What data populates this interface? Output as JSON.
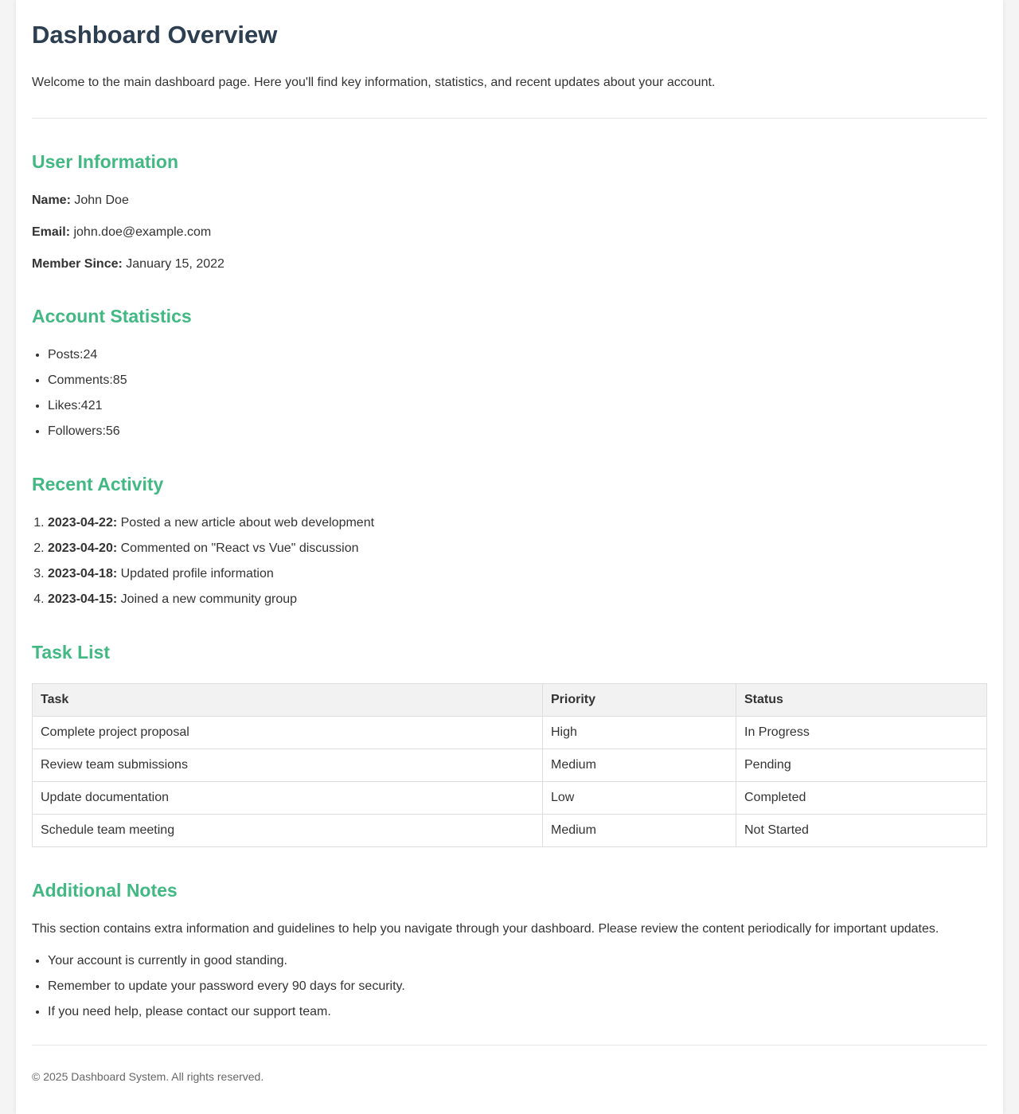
{
  "header": {
    "title": "Dashboard Overview",
    "intro": "Welcome to the main dashboard page. Here you'll find key information, statistics, and recent updates about your account."
  },
  "user_info": {
    "heading": "User Information",
    "name_label": "Name:",
    "name_value": "John Doe",
    "email_label": "Email:",
    "email_value": "john.doe@example.com",
    "member_label": "Member Since:",
    "member_value": "January 15, 2022"
  },
  "stats": {
    "heading": "Account Statistics",
    "items": [
      {
        "label": "Posts:",
        "value": "24"
      },
      {
        "label": "Comments:",
        "value": "85"
      },
      {
        "label": "Likes:",
        "value": "421"
      },
      {
        "label": "Followers:",
        "value": "56"
      }
    ]
  },
  "activity": {
    "heading": "Recent Activity",
    "items": [
      {
        "date": "2023-04-22:",
        "text": "Posted a new article about web development"
      },
      {
        "date": "2023-04-20:",
        "text": "Commented on \"React vs Vue\" discussion"
      },
      {
        "date": "2023-04-18:",
        "text": "Updated profile information"
      },
      {
        "date": "2023-04-15:",
        "text": "Joined a new community group"
      }
    ]
  },
  "tasks": {
    "heading": "Task List",
    "columns": [
      "Task",
      "Priority",
      "Status"
    ],
    "rows": [
      [
        "Complete project proposal",
        "High",
        "In Progress"
      ],
      [
        "Review team submissions",
        "Medium",
        "Pending"
      ],
      [
        "Update documentation",
        "Low",
        "Completed"
      ],
      [
        "Schedule team meeting",
        "Medium",
        "Not Started"
      ]
    ]
  },
  "notes": {
    "heading": "Additional Notes",
    "text": "This section contains extra information and guidelines to help you navigate through your dashboard. Please review the content periodically for important updates.",
    "items": [
      "Your account is currently in good standing.",
      "Remember to update your password every 90 days for security.",
      "If you need help, please contact our support team."
    ]
  },
  "footer": {
    "text": "© 2025 Dashboard System. All rights reserved."
  },
  "colors": {
    "title": "#2c3e50",
    "section_heading": "#42b883",
    "page_background": "#f4f4f4",
    "table_header_background": "#f2f2f2"
  }
}
